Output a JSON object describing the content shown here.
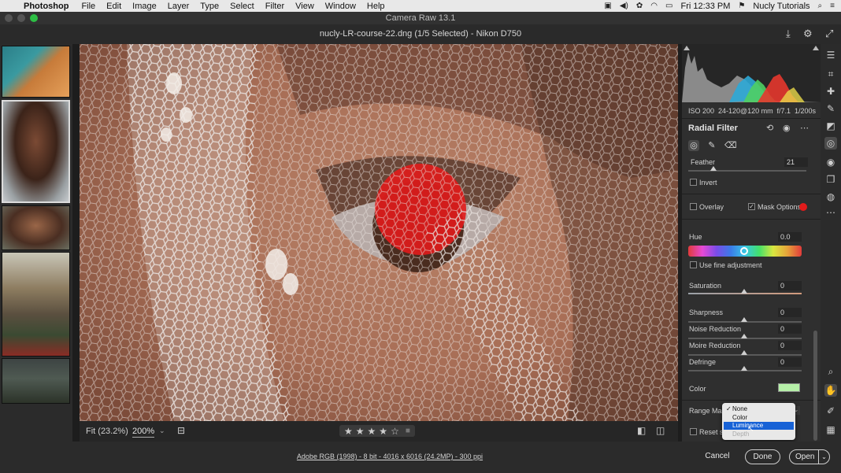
{
  "menubar": {
    "apple_glyph": "",
    "app": "Photoshop",
    "menus": [
      "File",
      "Edit",
      "Image",
      "Layer",
      "Type",
      "Select",
      "Filter",
      "View",
      "Window",
      "Help"
    ],
    "clock": "Fri 12:33 PM",
    "user": "Nucly Tutorials"
  },
  "window": {
    "title": "Camera Raw 13.1"
  },
  "header": {
    "filename": "nucly-LR-course-22.dng (1/5 Selected)  -  Nikon D750"
  },
  "exif": {
    "iso": "ISO 200",
    "lens": "24-120@120 mm",
    "aperture": "f/7.1",
    "shutter": "1/200s"
  },
  "panel": {
    "title": "Radial Filter",
    "feather": {
      "label": "Feather",
      "value": "21",
      "level": 0.21
    },
    "invert": {
      "label": "Invert",
      "checked": false
    },
    "overlay": {
      "label": "Overlay",
      "checked": false
    },
    "mask_options": {
      "label": "Mask Options",
      "checked": true,
      "color": "#e11b1b"
    },
    "hue": {
      "label": "Hue",
      "value": "0.0"
    },
    "fine_adjust": {
      "label": "Use fine adjustment"
    },
    "saturation": {
      "label": "Saturation",
      "value": "0"
    },
    "sharpness": {
      "label": "Sharpness",
      "value": "0"
    },
    "noise": {
      "label": "Noise Reduction",
      "value": "0"
    },
    "moire": {
      "label": "Moire Reduction",
      "value": "0"
    },
    "defringe": {
      "label": "Defringe",
      "value": "0"
    },
    "color": {
      "label": "Color",
      "swatch": "#b6f0a8"
    },
    "range_mask": {
      "label": "Range Mask"
    },
    "reset": {
      "label": "Reset sl"
    }
  },
  "dropdown": {
    "options": [
      {
        "label": "None",
        "checked": true
      },
      {
        "label": "Color"
      },
      {
        "label": "Luminance",
        "highlighted": true
      },
      {
        "label": "Depth",
        "disabled": true
      }
    ]
  },
  "viewbar": {
    "fit": "Fit (23.2%)",
    "zoom": "200%"
  },
  "rating": {
    "stars": [
      "★",
      "★",
      "★",
      "★",
      "☆"
    ]
  },
  "footer": {
    "info": "Adobe RGB (1998) - 8 bit - 4016 x 6016 (24.2MP) - 300 ppi",
    "cancel": "Cancel",
    "done": "Done",
    "open": "Open"
  },
  "colors": {
    "accent_blue": "#1762d6",
    "mask_red": "#e11b1b",
    "panel_bg": "#2f2f2f"
  }
}
